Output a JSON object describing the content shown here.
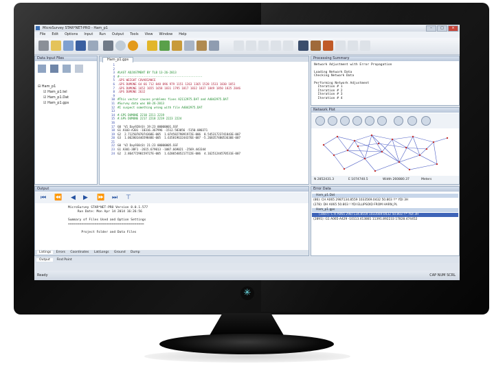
{
  "window": {
    "title": "MicroSurvey STAR*NET-PRO - Ham_p1",
    "controls": [
      "–",
      "□",
      "×"
    ]
  },
  "menu": [
    "File",
    "Edit",
    "Options",
    "Input",
    "Run",
    "Output",
    "Tools",
    "View",
    "Window",
    "Help"
  ],
  "panels": {
    "explorer_title": "Data Input Files",
    "editor_tab": "Ham_p1.gps",
    "processing_title": "Processing Summary",
    "plot_title": "Network Plot",
    "output_title": "Output",
    "errors_title": "Error Data"
  },
  "tree": {
    "root": "Ham_p1",
    "items": [
      "Ham_p1.tel",
      "Ham_p1.Dat",
      "Ham_p1.gps"
    ]
  },
  "editor": {
    "line_numbers": [
      "1",
      "2",
      "3",
      "4",
      "5",
      "6",
      "7",
      "8",
      "9",
      "10",
      "11",
      "12",
      "13",
      "14",
      "15",
      "16",
      "17",
      "18",
      "19",
      "20",
      "21",
      "22",
      "23",
      "24"
    ],
    "lines": [
      "",
      "",
      "#LAST ADJUSTMENT BY TLB 13-26-2013",
      "#------------------------------------------------",
      ".GPS WEIGHT COVARIANCE",
      ".GPS DUMONE 64 66 712 848 896 979 1151 1263 1365 1528 1533 1830 1851",
      ".GPS DUMONE 1652 1655 1658 1831 1795 1817 1832 1837 1849 1850 1825 2046",
      ".GPS DUMONE 2632",
      "",
      "#This vector causes problems fixes A2112975.DAT and A4042975.DAT",
      "#Survey data was 08-26-2013",
      "#I suspect something wrong with file A4042975.DAT",
      "",
      "#.GPS DUMONE 2210 2211 2219",
      "#.GPS DUMONE 2217 2218 2219 2223 2224",
      "",
      "G0 'V1 Day928(0) 19:23 00000001.SSF",
      "G1 A103-A301 -10316.367996 -1512.583056 -5150.080371",
      "G2  2.71250707074368E-005  1.07458279891972E-006  8.54531723741843E-007",
      "G3  1.06280144659848E-005  1.63581963244376E-007 -5.26835748053630E-007",
      "",
      "G0 'V2 Day930(0) 21:23 00000005.SSF",
      "G1 A301-3BF1 -2615.679013 -1087.669021 -2569.443344",
      "G2  2.86477290159727E-005  1.62065405217722E-006  4.16251244570531E-007"
    ]
  },
  "processing": {
    "lines": [
      "Network Adjustment with Error Propagation",
      "",
      "Loading Network Data",
      "Checking Network Data",
      "",
      "Performing Network Adjustment",
      "  Iteration # 1",
      "  Iteration # 2",
      "  Iteration # 3",
      "  Iteration # 4"
    ]
  },
  "plot_status": {
    "northing": "N 2852431.3",
    "easting": "E 1074740.5",
    "width": "Width 260880.37",
    "units": "Meters"
  },
  "output": {
    "lines": [
      "MicroSurvey STAR*NET-PRO Version 8.0.1.577",
      "     Run Date: Mon Apr 14 2014 16:26:56",
      "",
      "Summary of Files Used and Option Settings",
      "========================================",
      "",
      "       Project Folder and Data Files"
    ],
    "tabs": [
      "Listings",
      "Errors",
      "Coordinates",
      "Lat/Longs",
      "Ground",
      "Dump"
    ]
  },
  "errors": {
    "header1": "Ham_p1.Dat",
    "row1": "(86): CH A065  2987134.8559  1033569.0432  50.803 !!* YDI 3H",
    "row2": "(278): DH A065  50.803  ! YDI ELLIPSOID FROM HARN_PL",
    "header2": "Ham_p1.gps",
    "selected": "(1087): C H A065  2987134.8559  1033569.0432  50.803 !!* YDI 3H",
    "row3": "(2891): G1 A065-A429 -10113.413881 11391.892233 17828.474452"
  },
  "bottom_tabs": [
    "Output",
    "Find Point"
  ],
  "status": {
    "left": "Ready",
    "right": "CAP  NUM  SCRL"
  }
}
